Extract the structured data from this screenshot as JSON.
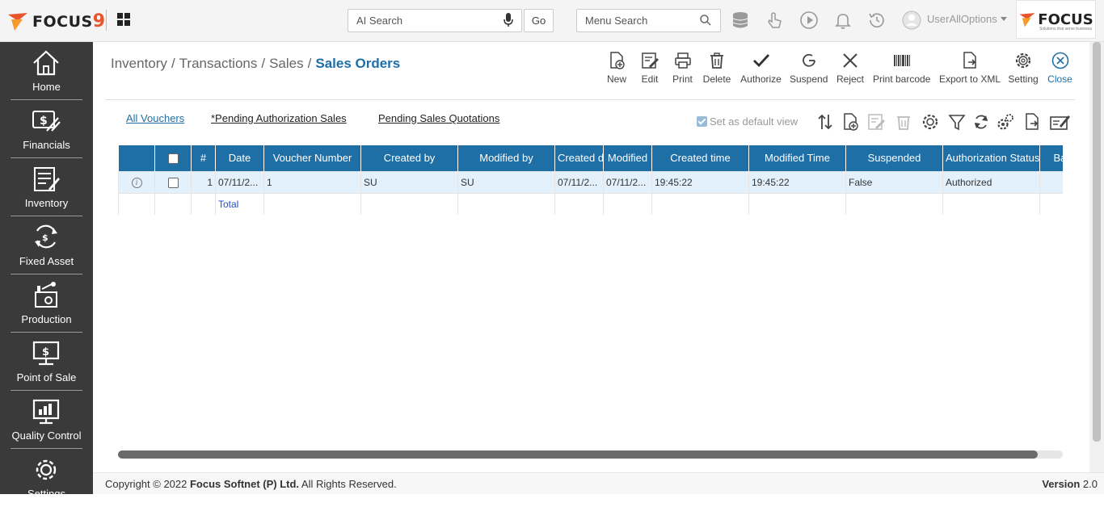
{
  "topbar": {
    "brand_name": "FOCUS",
    "brand_num": "9",
    "ai_search_placeholder": "AI Search",
    "go_label": "Go",
    "menu_search_placeholder": "Menu Search",
    "user_name": "UserAllOptions",
    "corner_brand": "FOCUS",
    "corner_tagline": "Solutions that serve business"
  },
  "sidebar": {
    "items": [
      {
        "label": "Home",
        "icon": "home-icon"
      },
      {
        "label": "Financials",
        "icon": "financials-icon"
      },
      {
        "label": "Inventory",
        "icon": "inventory-icon"
      },
      {
        "label": "Fixed Asset",
        "icon": "fixed-asset-icon"
      },
      {
        "label": "Production",
        "icon": "production-icon"
      },
      {
        "label": "Point of Sale",
        "icon": "point-of-sale-icon"
      },
      {
        "label": "Quality Control",
        "icon": "quality-control-icon"
      },
      {
        "label": "Settings",
        "icon": "settings-icon"
      }
    ]
  },
  "breadcrumb": {
    "items": [
      "Inventory",
      "Transactions",
      "Sales"
    ],
    "current": "Sales Orders",
    "separator": "/"
  },
  "toolbar": {
    "new": "New",
    "edit": "Edit",
    "print": "Print",
    "delete": "Delete",
    "authorize": "Authorize",
    "suspend": "Suspend",
    "reject": "Reject",
    "print_barcode": "Print barcode",
    "export_xml": "Export to XML",
    "setting": "Setting",
    "close": "Close"
  },
  "views": {
    "all": "All Vouchers",
    "pending_auth": "*Pending Authorization Sales",
    "pending_quotes": "Pending Sales Quotations",
    "default_view": "Set as default view",
    "default_view_checked": true
  },
  "grid": {
    "headers": [
      "#",
      "Date",
      "Voucher Number",
      "Created by",
      "Modified by",
      "Created d",
      "Modified",
      "Created time",
      "Modified Time",
      "Suspended",
      "Authorization Status",
      "Bala"
    ],
    "rows": [
      {
        "num": "1",
        "date": "07/11/2...",
        "voucher": "1",
        "created_by": "SU",
        "modified_by": "SU",
        "created_d": "07/11/2...",
        "modified": "07/11/2...",
        "created_time": "19:45:22",
        "modified_time": "19:45:22",
        "suspended": "False",
        "auth_status": "Authorized",
        "bala": ""
      }
    ],
    "total_label": "Total"
  },
  "footer": {
    "copyright_prefix": "Copyright © 2022 ",
    "company": "Focus Softnet (P) Ltd.",
    "rights": " All Rights Reserved.",
    "version_label": "Version",
    "version": "2.0"
  },
  "colors": {
    "accent": "#1f6fa7",
    "sidebar_bg": "#3a3a3a",
    "row_highlight": "#e2f1fb",
    "brand_orange": "#e8542b"
  }
}
